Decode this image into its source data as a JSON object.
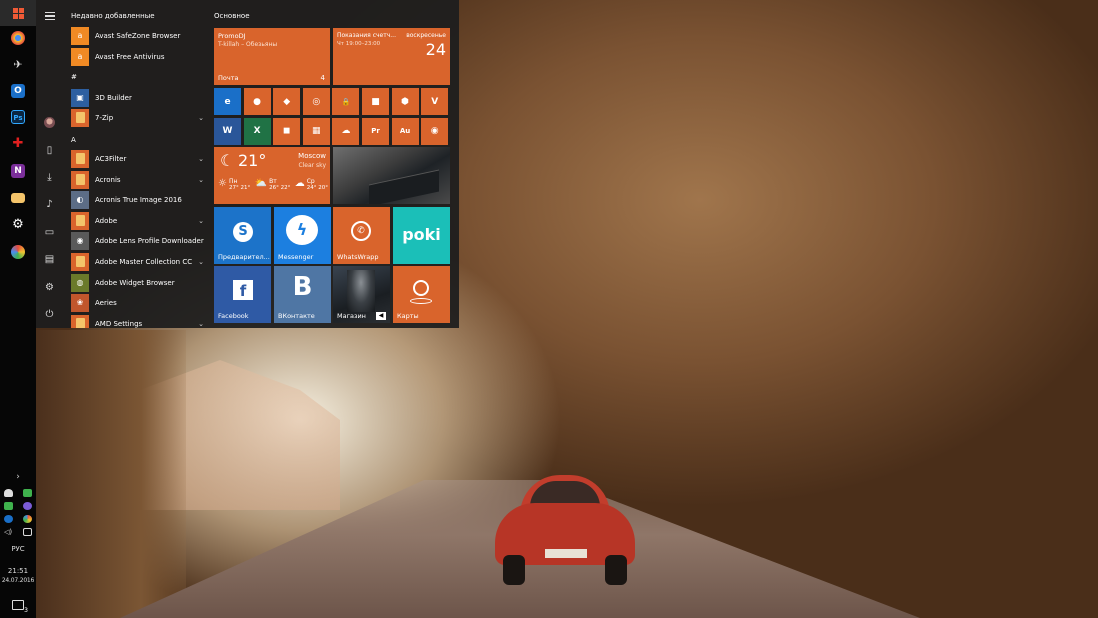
{
  "start_menu": {
    "recent_heading": "Недавно добавленные",
    "tiles_heading": "Основное",
    "groups": {
      "hash": "#",
      "a": "A"
    },
    "apps": [
      {
        "label": "Avast SafeZone Browser",
        "icon": "avast-icon",
        "color": "#f08a24"
      },
      {
        "label": "Avast Free Antivirus",
        "icon": "avast-icon",
        "color": "#f08a24"
      },
      {
        "label": "3D Builder",
        "icon": "3d-builder-icon",
        "color": "#2d5fa0"
      },
      {
        "label": "7-Zip",
        "icon": "folder-icon",
        "chevron": "⌄"
      },
      {
        "label": "AC3Filter",
        "icon": "folder-icon",
        "chevron": "⌄"
      },
      {
        "label": "Acronis",
        "icon": "folder-icon",
        "chevron": "⌄"
      },
      {
        "label": "Acronis True Image 2016",
        "icon": "acronis-icon",
        "color": "#5c6d86"
      },
      {
        "label": "Adobe",
        "icon": "folder-icon",
        "chevron": "⌄"
      },
      {
        "label": "Adobe Lens Profile Downloader",
        "icon": "adobe-lens-icon",
        "color": "#5a5a5a"
      },
      {
        "label": "Adobe Master Collection CC",
        "icon": "folder-icon",
        "chevron": "⌄"
      },
      {
        "label": "Adobe Widget Browser",
        "icon": "adobe-widget-icon",
        "color": "#6b7a2a"
      },
      {
        "label": "Aeries",
        "icon": "aeries-icon",
        "color": "#c0562c"
      },
      {
        "label": "AMD Settings",
        "icon": "folder-icon",
        "chevron": "⌄"
      }
    ],
    "tiles": {
      "promodj": {
        "title": "PromoDJ",
        "subtitle": "T-killah – Обезьяны"
      },
      "mail": {
        "label": "Почта",
        "count": "4"
      },
      "calendar": {
        "title": "Показания счетч...",
        "time": "Чт 19:00–23:00",
        "day": "воскресенье",
        "date": "24"
      },
      "weather": {
        "temp": "21°",
        "city": "Moscow",
        "condition": "Clear sky",
        "forecast": [
          {
            "day": "Пн",
            "temps": "27° 21°"
          },
          {
            "day": "Вт",
            "temps": "26° 22°"
          },
          {
            "day": "Ср",
            "temps": "24° 20°"
          }
        ]
      },
      "skype": {
        "label": "Предварител..."
      },
      "messenger": {
        "label": "Messenger"
      },
      "whatsapp": {
        "label": "WhatsWrapp"
      },
      "poki": {
        "label": "poki"
      },
      "facebook": {
        "label": "Facebook"
      },
      "vk": {
        "label": "ВКонтакте",
        "glyph": "B"
      },
      "store": {
        "label": "Магазин"
      },
      "maps": {
        "label": "Карты"
      },
      "small": [
        {
          "icon": "edge-icon",
          "glyph": "e",
          "bg": "#1a6fc8"
        },
        {
          "icon": "firefox-icon",
          "glyph": "●",
          "bg": "#d9642c"
        },
        {
          "icon": "app-red-icon",
          "glyph": "◆",
          "bg": "#d9642c"
        },
        {
          "icon": "app-blue-circle-icon",
          "glyph": "◎",
          "bg": "#d9642c"
        },
        {
          "icon": "vpn-lock-icon",
          "glyph": "🔒",
          "bg": "#d9642c"
        },
        {
          "icon": "app-cube-icon",
          "glyph": "■",
          "bg": "#d9642c"
        },
        {
          "icon": "shield-green-icon",
          "glyph": "⬢",
          "bg": "#d9642c"
        },
        {
          "icon": "arrow-v-icon",
          "glyph": "V",
          "bg": "#d9642c"
        },
        {
          "icon": "word-icon",
          "glyph": "W",
          "bg": "#2a5699"
        },
        {
          "icon": "excel-icon",
          "glyph": "X",
          "bg": "#207245"
        },
        {
          "icon": "paint3d-icon",
          "glyph": "◼",
          "bg": "#d9642c"
        },
        {
          "icon": "calculator-icon",
          "glyph": "▦",
          "bg": "#d9642c"
        },
        {
          "icon": "onedrive-icon",
          "glyph": "☁",
          "bg": "#d9642c"
        },
        {
          "icon": "premiere-icon",
          "glyph": "Pr",
          "bg": "#d9642c"
        },
        {
          "icon": "audition-icon",
          "glyph": "Au",
          "bg": "#d9642c"
        },
        {
          "icon": "chrome-icon",
          "glyph": "◉",
          "bg": "#d9642c"
        }
      ]
    }
  },
  "taskbar": {
    "language": "РУС",
    "time": "21:51",
    "date": "24.07.2016",
    "chevron": "›",
    "notification_badge": "3"
  }
}
